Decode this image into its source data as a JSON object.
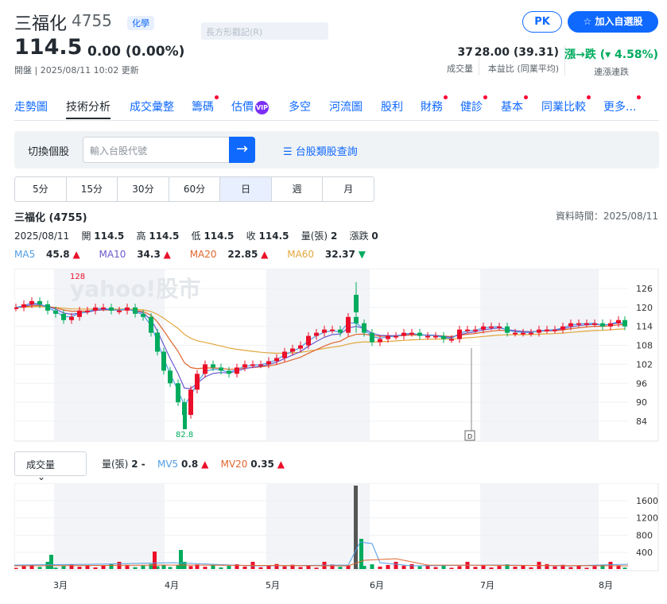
{
  "header": {
    "name": "三福化",
    "code": "4755",
    "tag": "化學",
    "faint_text": "長方形戳記(R)",
    "pk_label": "PK",
    "watch_label": "☆  加入自選股",
    "price": "114.5",
    "change": "0.00 (0.00%)",
    "status": "開盤 | 2025/08/11 10:02 更新",
    "stats": [
      {
        "value": "37",
        "label": "成交量"
      },
      {
        "value": "28.00 (39.31)",
        "label": "本益比 (同業平均)"
      },
      {
        "value": "漲→跌 (▾ 4.58%)",
        "label": "連漲連跌"
      }
    ]
  },
  "tabs": [
    "走勢圖",
    "技術分析",
    "成交彙整",
    "籌碼",
    "估價",
    "多空",
    "河流圖",
    "股利",
    "財務",
    "健診",
    "基本",
    "同業比較",
    "更多..."
  ],
  "vip_label": "VIP",
  "search": {
    "label": "切換個股",
    "placeholder": "輸入台股代號",
    "category_link": "☰ 台股類股查詢"
  },
  "periods": [
    "5分",
    "15分",
    "30分",
    "60分",
    "日",
    "週",
    "月"
  ],
  "info": {
    "title": "三福化 (4755)",
    "data_time": "資料時間：2025/08/11",
    "date": "2025/08/11",
    "open_label": "開",
    "open": "114.5",
    "high_label": "高",
    "high": "114.5",
    "low_label": "低",
    "low": "114.5",
    "close_label": "收",
    "close": "114.5",
    "vol_label": "量(張)",
    "vol": "2",
    "updown_label": "漲跌",
    "updown": "0"
  },
  "ma": [
    {
      "name": "MA5",
      "value": "45.8",
      "dir": "▲",
      "color": "#4f9ee6"
    },
    {
      "name": "MA10",
      "value": "34.3",
      "dir": "▲",
      "color": "#6a5acd"
    },
    {
      "name": "MA20",
      "value": "22.85",
      "dir": "▲",
      "color": "#e0662e"
    },
    {
      "name": "MA60",
      "value": "32.37",
      "dir": "▼",
      "color": "#e2a73d"
    }
  ],
  "volume": {
    "select": "成交量",
    "label": "量(張)",
    "value": "2 -",
    "mv5_label": "MV5",
    "mv5": "0.8",
    "mv5_color": "#4f9ee6",
    "mv20_label": "MV20",
    "mv20": "0.35",
    "mv20_color": "#e0662e"
  },
  "chart_data": {
    "type": "candlestick",
    "watermark": "yahoo!股市",
    "price_ticks": [
      "126",
      "120",
      "114",
      "108",
      "102",
      "96",
      "90",
      "84"
    ],
    "high_label": "128",
    "low_label": "82.8",
    "volume_ticks": [
      "1600",
      "1200",
      "800",
      "400"
    ],
    "months": [
      "3月",
      "4月",
      "5月",
      "6月",
      "7月",
      "8月"
    ],
    "dividend_marker": "D"
  },
  "colors": {
    "accent": "#0f69ff",
    "up": "#eb0f29",
    "down": "#00ab5e"
  }
}
